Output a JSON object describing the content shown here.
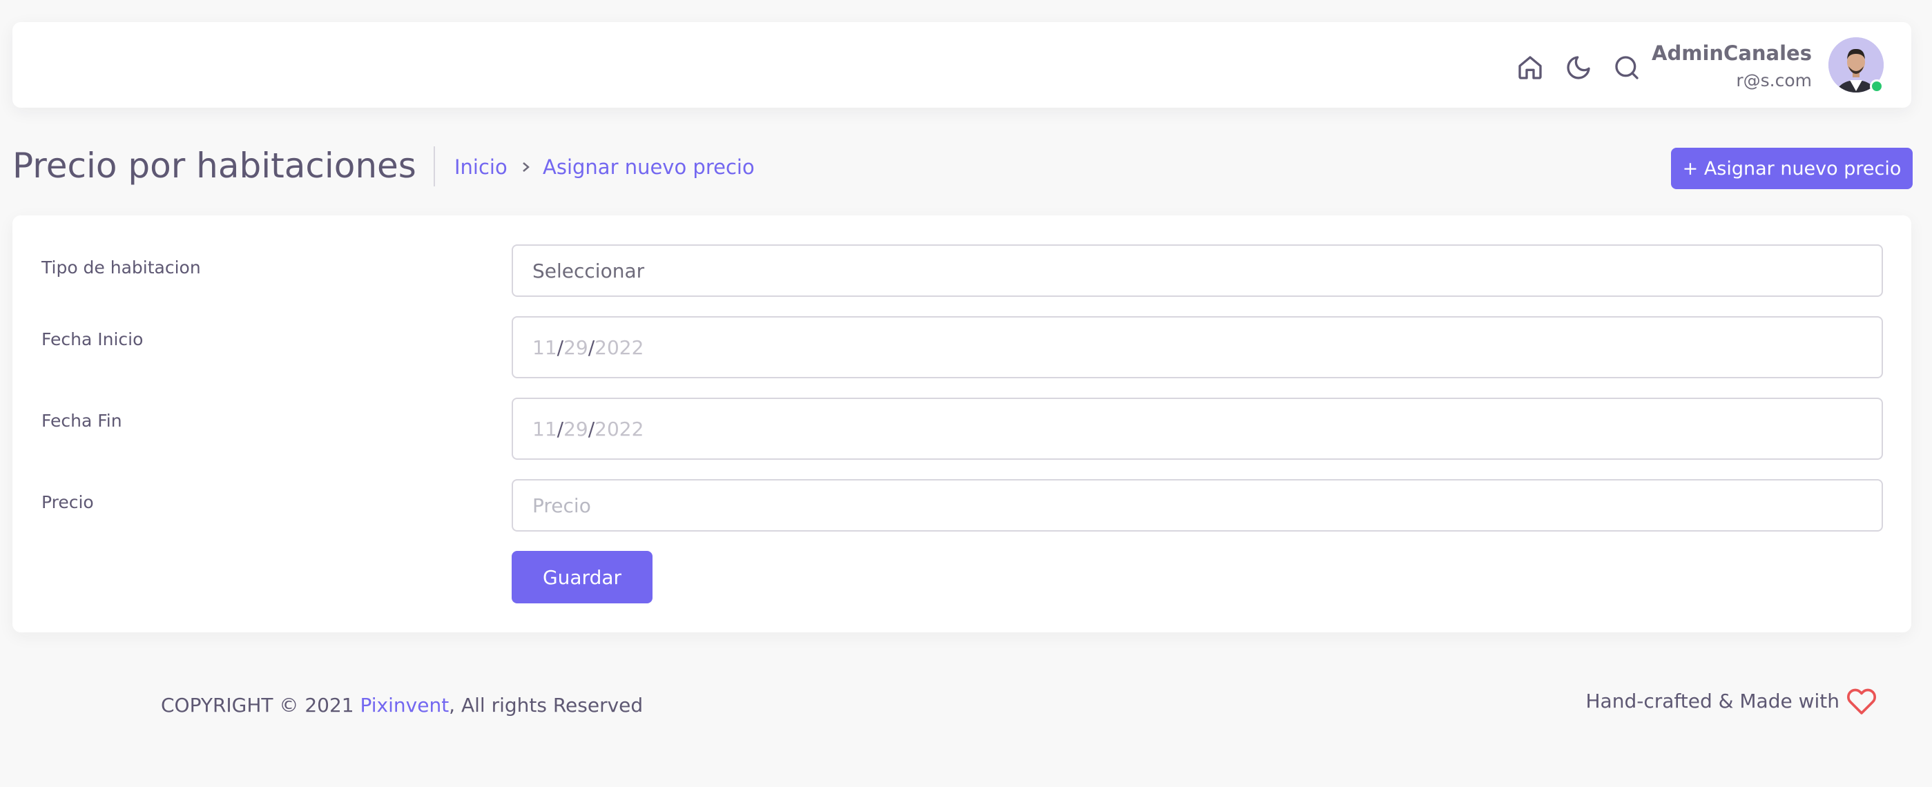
{
  "navbar": {
    "icons": [
      "home-icon",
      "moon-icon",
      "search-icon"
    ],
    "user": {
      "name": "AdminCanales",
      "email": "r@s.com",
      "status_color": "#28c76f"
    }
  },
  "header": {
    "title": "Precio por habitaciones",
    "breadcrumb": [
      "Inicio",
      "Asignar nuevo precio"
    ],
    "action_label": "+ Asignar nuevo precio"
  },
  "form": {
    "room_type": {
      "label": "Tipo de habitacion",
      "value": "Seleccionar"
    },
    "start_date": {
      "label": "Fecha Inicio",
      "month": "11",
      "day": "29",
      "year": "2022"
    },
    "end_date": {
      "label": "Fecha Fin",
      "month": "11",
      "day": "29",
      "year": "2022"
    },
    "price": {
      "label": "Precio",
      "placeholder": "Precio"
    },
    "save_label": "Guardar"
  },
  "footer": {
    "copyright_prefix": "COPYRIGHT © 2021 ",
    "company": "Pixinvent",
    "copyright_suffix": ", All rights Reserved",
    "made_with": "Hand-crafted & Made with"
  },
  "colors": {
    "primary": "#7367f0",
    "danger": "#ea5455",
    "background": "#f8f8f8"
  }
}
